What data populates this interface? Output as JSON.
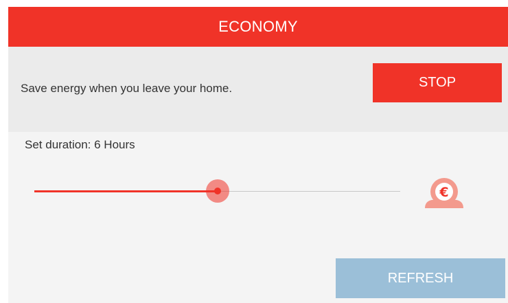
{
  "header": {
    "title": "ECONOMY"
  },
  "info": {
    "description": "Save energy when you leave your home.",
    "stop_label": "STOP"
  },
  "duration": {
    "label": "Set duration: 6 Hours",
    "slider_fraction": 0.5
  },
  "actions": {
    "refresh_label": "REFRESH"
  },
  "icons": {
    "savings": "euro-coin-icon"
  },
  "colors": {
    "accent": "#f03328",
    "refresh_button": "#9bbfd8",
    "icon": "#f39a8d",
    "background": "#f4f4f4",
    "info_row": "#ebebeb"
  }
}
